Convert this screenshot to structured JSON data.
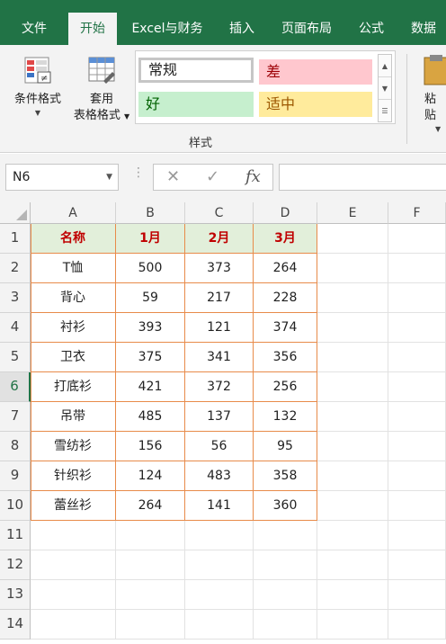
{
  "tabs": [
    "文件",
    "开始",
    "Excel与财务",
    "插入",
    "页面布局",
    "公式",
    "数据"
  ],
  "ribbon": {
    "cond_format": "条件格式",
    "table_format_1": "套用",
    "table_format_2": "表格格式",
    "styles": {
      "normal": "常规",
      "bad": "差",
      "good": "好",
      "neutral": "适中"
    },
    "group_label": "样式",
    "paste": "粘贴"
  },
  "formula_bar": {
    "name_box": "N6",
    "fx": "fx",
    "cancel": "✕",
    "confirm": "✓"
  },
  "grid": {
    "columns": [
      "A",
      "B",
      "C",
      "D",
      "E",
      "F"
    ],
    "rows": [
      "1",
      "2",
      "3",
      "4",
      "5",
      "6",
      "7",
      "8",
      "9",
      "10",
      "11",
      "12",
      "13",
      "14"
    ],
    "selected_row": "6",
    "table": [
      [
        "名称",
        "1月",
        "2月",
        "3月"
      ],
      [
        "T恤",
        "500",
        "373",
        "264"
      ],
      [
        "背心",
        "59",
        "217",
        "228"
      ],
      [
        "衬衫",
        "393",
        "121",
        "374"
      ],
      [
        "卫衣",
        "375",
        "341",
        "356"
      ],
      [
        "打底衫",
        "421",
        "372",
        "256"
      ],
      [
        "吊带",
        "485",
        "137",
        "132"
      ],
      [
        "雪纺衫",
        "156",
        "56",
        "95"
      ],
      [
        "针织衫",
        "124",
        "483",
        "358"
      ],
      [
        "蕾丝衫",
        "264",
        "141",
        "360"
      ]
    ]
  },
  "colors": {
    "ribbon_green": "#217346",
    "header_fill": "#e2efda",
    "header_text": "#c00000",
    "table_border": "#e88b4a"
  }
}
